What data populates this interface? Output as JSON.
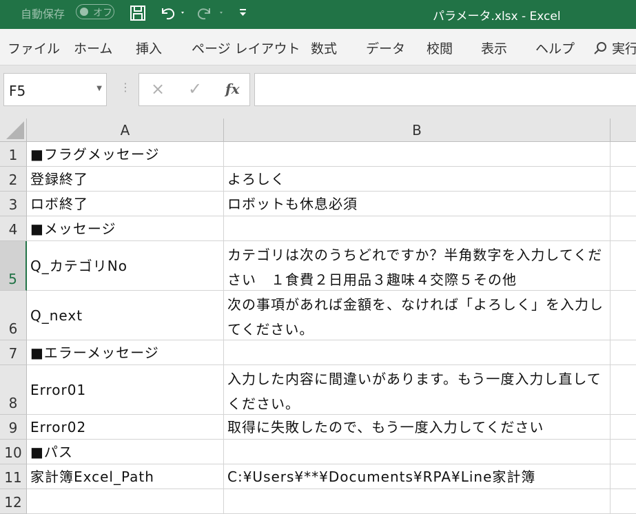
{
  "titlebar": {
    "autosave_label": "自動保存",
    "autosave_state": "オフ",
    "title": "パラメータ.xlsx  -  Excel",
    "accent": "#217346"
  },
  "ribbon": {
    "tabs": [
      "ファイル",
      "ホーム",
      "挿入",
      "ページ レイアウト",
      "数式",
      "データ",
      "校閲",
      "表示",
      "ヘルプ"
    ],
    "search_label": "実行"
  },
  "formula_bar": {
    "name_box": "F5",
    "cancel_icon": "×",
    "enter_icon": "✓",
    "fx_label": "fx",
    "formula": ""
  },
  "sheet": {
    "columns": [
      "A",
      "B"
    ],
    "rows": [
      {
        "num": "1",
        "a": "■フラグメッセージ",
        "b": ""
      },
      {
        "num": "2",
        "a": "登録終了",
        "b": "よろしく"
      },
      {
        "num": "3",
        "a": "ロボ終了",
        "b": "ロボットも休息必須"
      },
      {
        "num": "4",
        "a": "■メッセージ",
        "b": ""
      },
      {
        "num": "5",
        "a": "Q_カテゴリNo",
        "b": "カテゴリは次のうちどれですか？半角数字を入力してください　１食費２日用品３趣味４交際５その他"
      },
      {
        "num": "6",
        "a": "Q_next",
        "b": "次の事項があれば金額を、なければ「よろしく」を入力してください。"
      },
      {
        "num": "7",
        "a": "■エラーメッセージ",
        "b": ""
      },
      {
        "num": "8",
        "a": "Error01",
        "b": "入力した内容に間違いがあります。もう一度入力し直してください。"
      },
      {
        "num": "9",
        "a": "Error02",
        "b": "取得に失敗したので、もう一度入力してください"
      },
      {
        "num": "10",
        "a": "■パス",
        "b": ""
      },
      {
        "num": "11",
        "a": "家計簿Excel_Path",
        "b": "C:¥Users¥**¥Documents¥RPA¥Line家計簿"
      },
      {
        "num": "12",
        "a": "",
        "b": ""
      }
    ]
  }
}
